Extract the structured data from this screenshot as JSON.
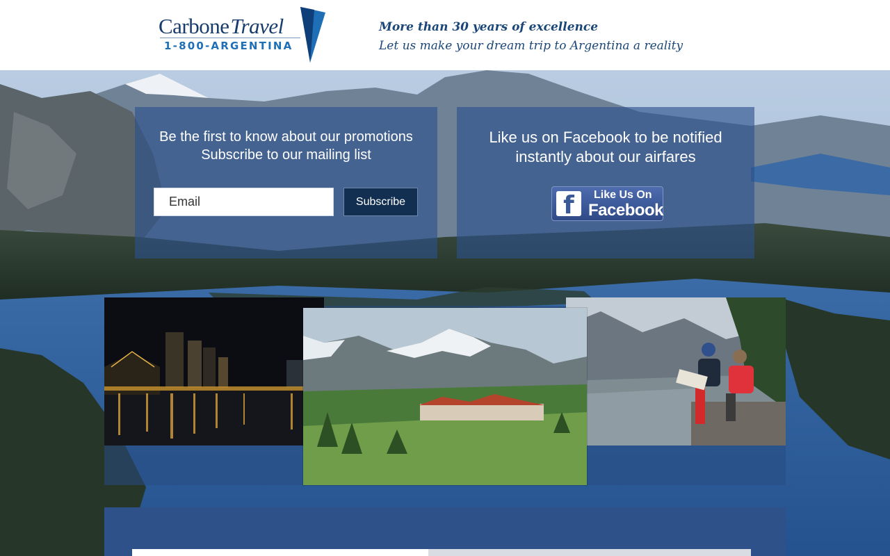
{
  "header": {
    "logo_name": "Carbone",
    "logo_name_italic": "Travel",
    "logo_phone": "1-800-ARGENTINA",
    "tagline_line1": "More than 30 years of excellence",
    "tagline_line2": "Let us make your dream trip to Argentina a reality"
  },
  "newsletter": {
    "heading_line1": "Be the first to know about our promotions",
    "heading_line2": "Subscribe to our mailing list",
    "email_placeholder": "Email",
    "subscribe_label": "Subscribe"
  },
  "facebook": {
    "heading_line1": "Like us on Facebook to be notified",
    "heading_line2": "instantly about our airfares",
    "button_line1": "Like Us On",
    "button_line2": "Facebook",
    "icon": "facebook-f-icon"
  },
  "colors": {
    "brand_navy": "#173c6b",
    "brand_blue": "#1f6fb7",
    "panel_blue": "#2b508c",
    "button_dark": "#122f51",
    "facebook_blue": "#3b5897"
  },
  "photos": [
    "night-city-waterfront",
    "mountain-lodge",
    "hikers-by-lake"
  ]
}
